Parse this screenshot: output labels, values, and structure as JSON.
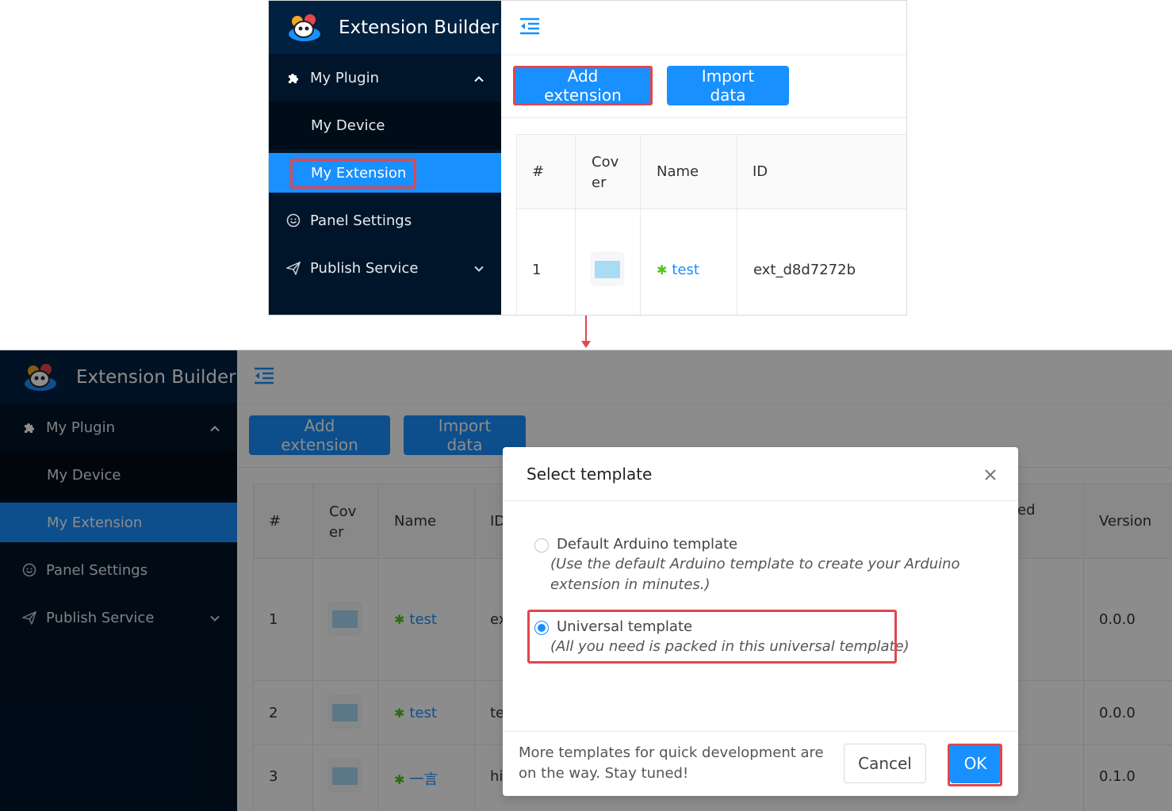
{
  "brand": {
    "title": "Extension Builder"
  },
  "sidebar": {
    "group": {
      "label": "My Plugin"
    },
    "items": [
      {
        "label": "My Device"
      },
      {
        "label": "My Extension"
      },
      {
        "label": "Panel Settings"
      },
      {
        "label": "Publish Service"
      }
    ]
  },
  "toolbar": {
    "add_label": "Add extension",
    "import_label": "Import data"
  },
  "table": {
    "columns": [
      "#",
      "Cov\ner",
      "Name",
      "ID"
    ],
    "extra_columns": {
      "partial": "ed",
      "version": "Version"
    },
    "rows": [
      {
        "num": "1",
        "name": "test",
        "id": "ext_d8d7272b",
        "id_partial": "ex",
        "version": "0.0.0"
      },
      {
        "num": "2",
        "name": "test",
        "id_partial": "te",
        "version": "0.0.0"
      },
      {
        "num": "3",
        "name": "一言",
        "id_partial": "hi",
        "version": "0.1.0"
      }
    ]
  },
  "modal": {
    "title": "Select template",
    "options": [
      {
        "title": "Default Arduino template",
        "desc": "(Use the default Arduino template to create your Arduino extension in minutes.)",
        "checked": false
      },
      {
        "title": "Universal template",
        "desc": "(All you need is packed in this universal template)",
        "checked": true
      }
    ],
    "footer_note": "More templates for quick development are on the way. Stay tuned!",
    "cancel_label": "Cancel",
    "ok_label": "OK"
  },
  "colors": {
    "sidebar": "#001529",
    "primary": "#1890ff",
    "highlight": "#e0474c",
    "puzzle": "#52c41a"
  },
  "icons": [
    "logo-icon",
    "puzzle-icon",
    "chevron-up-icon",
    "smile-icon",
    "send-icon",
    "chevron-down-icon",
    "menu-fold-icon",
    "close-icon"
  ]
}
